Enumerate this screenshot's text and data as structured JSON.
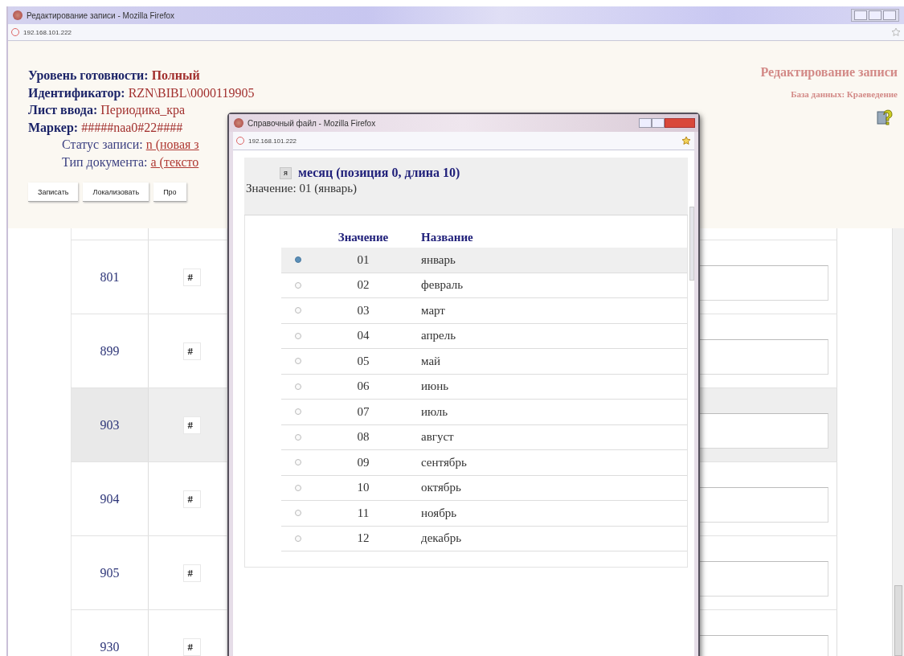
{
  "main_window": {
    "title": "Редактирование записи - Mozilla Firefox",
    "address": "192.168.101.222"
  },
  "record_info": [
    {
      "kind": "heading",
      "label": "Уровень готовности:",
      "value": "Полный"
    },
    {
      "kind": "heading",
      "label": "Идентификатор:",
      "value": "RZN\\BIBL\\0000119905"
    },
    {
      "kind": "heading",
      "label": "Лист ввода:",
      "value": "Периодика_кра"
    },
    {
      "kind": "heading",
      "label": "Маркер:",
      "value": "#####naa0#22####"
    },
    {
      "kind": "field",
      "label": "Статус записи:",
      "value": "n (новая з"
    },
    {
      "kind": "field",
      "label": "Тип документа:",
      "value": "a (тексто"
    }
  ],
  "page_title": "Редактирование записи",
  "database": "База данных: Краеведение",
  "buttons": [
    "Записать",
    "Локализовать",
    "Про"
  ],
  "fields": [
    {
      "tag": "801",
      "indicator": "#",
      "selected": false
    },
    {
      "tag": "899",
      "indicator": "#",
      "selected": false
    },
    {
      "tag": "903",
      "indicator": "#",
      "selected": true
    },
    {
      "tag": "904",
      "indicator": "#",
      "selected": false
    },
    {
      "tag": "905",
      "indicator": "#",
      "selected": false
    },
    {
      "tag": "930",
      "indicator": "#",
      "selected": false
    }
  ],
  "popup": {
    "title": "Справочный файл - Mozilla Firefox",
    "address": "192.168.101.222",
    "icon_label": "я",
    "heading": "месяц (позиция 0, длина 10)",
    "value_line": "Значение: 01 (январь)",
    "columns": [
      "Значение",
      "Название"
    ],
    "rows": [
      {
        "value": "01",
        "name": "январь",
        "selected": true
      },
      {
        "value": "02",
        "name": "февраль",
        "selected": false
      },
      {
        "value": "03",
        "name": "март",
        "selected": false
      },
      {
        "value": "04",
        "name": "апрель",
        "selected": false
      },
      {
        "value": "05",
        "name": "май",
        "selected": false
      },
      {
        "value": "06",
        "name": "июнь",
        "selected": false
      },
      {
        "value": "07",
        "name": "июль",
        "selected": false
      },
      {
        "value": "08",
        "name": "август",
        "selected": false
      },
      {
        "value": "09",
        "name": "сентябрь",
        "selected": false
      },
      {
        "value": "10",
        "name": "октябрь",
        "selected": false
      },
      {
        "value": "11",
        "name": "ноябрь",
        "selected": false
      },
      {
        "value": "12",
        "name": "декабрь",
        "selected": false
      }
    ]
  }
}
